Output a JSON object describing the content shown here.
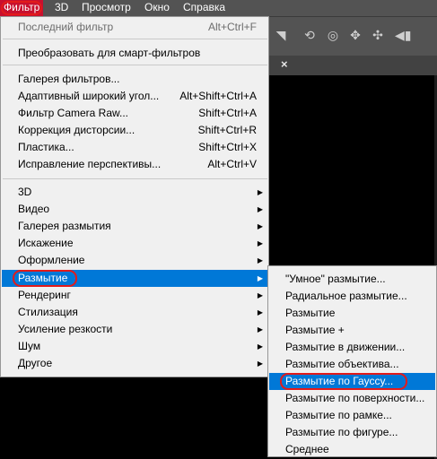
{
  "menubar": {
    "items": [
      "Фильтр",
      "3D",
      "Просмотр",
      "Окно",
      "Справка"
    ]
  },
  "filter_menu": {
    "items": [
      {
        "label": "Последний фильтр",
        "shortcut": "Alt+Ctrl+F",
        "disabled": true
      },
      {
        "label": "Преобразовать для смарт-фильтров",
        "shortcut": ""
      },
      {
        "label": "Галерея фильтров...",
        "shortcut": ""
      },
      {
        "label": "Адаптивный широкий угол...",
        "shortcut": "Alt+Shift+Ctrl+A"
      },
      {
        "label": "Фильтр Camera Raw...",
        "shortcut": "Shift+Ctrl+A"
      },
      {
        "label": "Коррекция дисторсии...",
        "shortcut": "Shift+Ctrl+R"
      },
      {
        "label": "Пластика...",
        "shortcut": "Shift+Ctrl+X"
      },
      {
        "label": "Исправление перспективы...",
        "shortcut": "Alt+Ctrl+V"
      },
      {
        "label": "3D",
        "submenu": true
      },
      {
        "label": "Видео",
        "submenu": true
      },
      {
        "label": "Галерея размытия",
        "submenu": true
      },
      {
        "label": "Искажение",
        "submenu": true
      },
      {
        "label": "Оформление",
        "submenu": true
      },
      {
        "label": "Размытие",
        "submenu": true,
        "highlighted": true
      },
      {
        "label": "Рендеринг",
        "submenu": true
      },
      {
        "label": "Стилизация",
        "submenu": true
      },
      {
        "label": "Усиление резкости",
        "submenu": true
      },
      {
        "label": "Шум",
        "submenu": true
      },
      {
        "label": "Другое",
        "submenu": true
      }
    ]
  },
  "blur_submenu": {
    "items": [
      {
        "label": "\"Умное\" размытие..."
      },
      {
        "label": "Радиальное размытие..."
      },
      {
        "label": "Размытие"
      },
      {
        "label": "Размытие +"
      },
      {
        "label": "Размытие в движении..."
      },
      {
        "label": "Размытие объектива..."
      },
      {
        "label": "Размытие по Гауссу...",
        "highlighted": true
      },
      {
        "label": "Размытие по поверхности..."
      },
      {
        "label": "Размытие по рамке..."
      },
      {
        "label": "Размытие по фигуре..."
      },
      {
        "label": "Среднее"
      }
    ]
  },
  "document_tab": {
    "close_glyph": "×"
  },
  "colors": {
    "highlight": "#0078d7",
    "annotation_ring": "#e21b1b",
    "menu_bg": "#f0f0f0",
    "app_bg": "#535353"
  }
}
